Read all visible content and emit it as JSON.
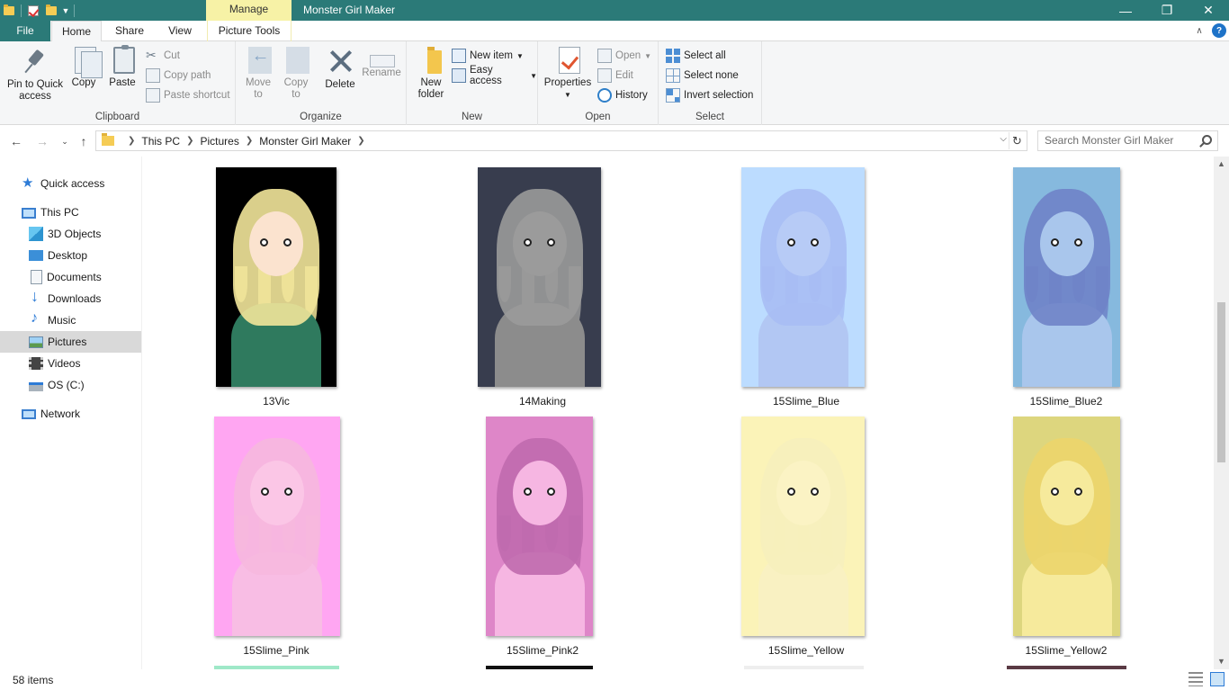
{
  "window": {
    "title": "Monster Girl Maker",
    "context_tab": "Manage",
    "controls": {
      "minimize": "—",
      "restore": "❐",
      "close": "✕"
    }
  },
  "ribbon_tabs": {
    "file": "File",
    "home": "Home",
    "share": "Share",
    "view": "View",
    "picture_tools": "Picture Tools",
    "collapse": "∧",
    "help": "?"
  },
  "ribbon": {
    "clipboard": {
      "label": "Clipboard",
      "pin": "Pin to Quick access",
      "pin_l1": "Pin to Quick",
      "pin_l2": "access",
      "copy": "Copy",
      "paste": "Paste",
      "cut": "Cut",
      "copy_path": "Copy path",
      "paste_shortcut": "Paste shortcut"
    },
    "organize": {
      "label": "Organize",
      "move_l1": "Move",
      "move_l2": "to",
      "copy_l1": "Copy",
      "copy_l2": "to",
      "delete": "Delete",
      "rename": "Rename"
    },
    "new": {
      "label": "New",
      "folder_l1": "New",
      "folder_l2": "folder",
      "new_item": "New item",
      "easy_access": "Easy access"
    },
    "open": {
      "label": "Open",
      "properties": "Properties",
      "open": "Open",
      "edit": "Edit",
      "history": "History"
    },
    "select": {
      "label": "Select",
      "select_all": "Select all",
      "select_none": "Select none",
      "invert": "Invert selection"
    }
  },
  "address": {
    "crumbs": [
      "This PC",
      "Pictures",
      "Monster Girl Maker"
    ],
    "search_placeholder": "Search Monster Girl Maker"
  },
  "nav": {
    "quick_access": "Quick access",
    "this_pc": "This PC",
    "objects3d": "3D Objects",
    "desktop": "Desktop",
    "documents": "Documents",
    "downloads": "Downloads",
    "music": "Music",
    "pictures": "Pictures",
    "videos": "Videos",
    "os": "OS (C:)",
    "network": "Network"
  },
  "files": [
    {
      "name": "13Vic",
      "bg": "#000000",
      "hair": "#f2e59a",
      "skin": "#fbe3cf",
      "body": "#2f7a5e"
    },
    {
      "name": "14Making",
      "bg": "#383d4e",
      "hair": "#9a9a9a",
      "skin": "#9b9b9b",
      "body": "#8c8c8c"
    },
    {
      "name": "15Slime_Blue",
      "bg": "#bcdcff",
      "hair": "#a7bdf4",
      "skin": "#b7cbf6",
      "body": "#b2c7f3"
    },
    {
      "name": "15Slime_Blue2",
      "bg": "#86b9de",
      "hair": "#6f83c8",
      "skin": "#a9c6ec",
      "body": "#a9c6ec"
    },
    {
      "name": "15Slime_Pink",
      "bg": "#ffa6f2",
      "hair": "#f6b8de",
      "skin": "#fbc6e6",
      "body": "#f8bde4"
    },
    {
      "name": "15Slime_Pink2",
      "bg": "#de86c8",
      "hair": "#c06aae",
      "skin": "#f6b6e2",
      "body": "#f6b6e2"
    },
    {
      "name": "15Slime_Yellow",
      "bg": "#fbf3b8",
      "hair": "#f6efbd",
      "skin": "#fbf3c4",
      "body": "#f9f1c2"
    },
    {
      "name": "15Slime_Yellow2",
      "bg": "#ddd67e",
      "hair": "#ecd56b",
      "skin": "#f6ea9c",
      "body": "#f6ea9c"
    }
  ],
  "status": {
    "count": "58 items"
  }
}
